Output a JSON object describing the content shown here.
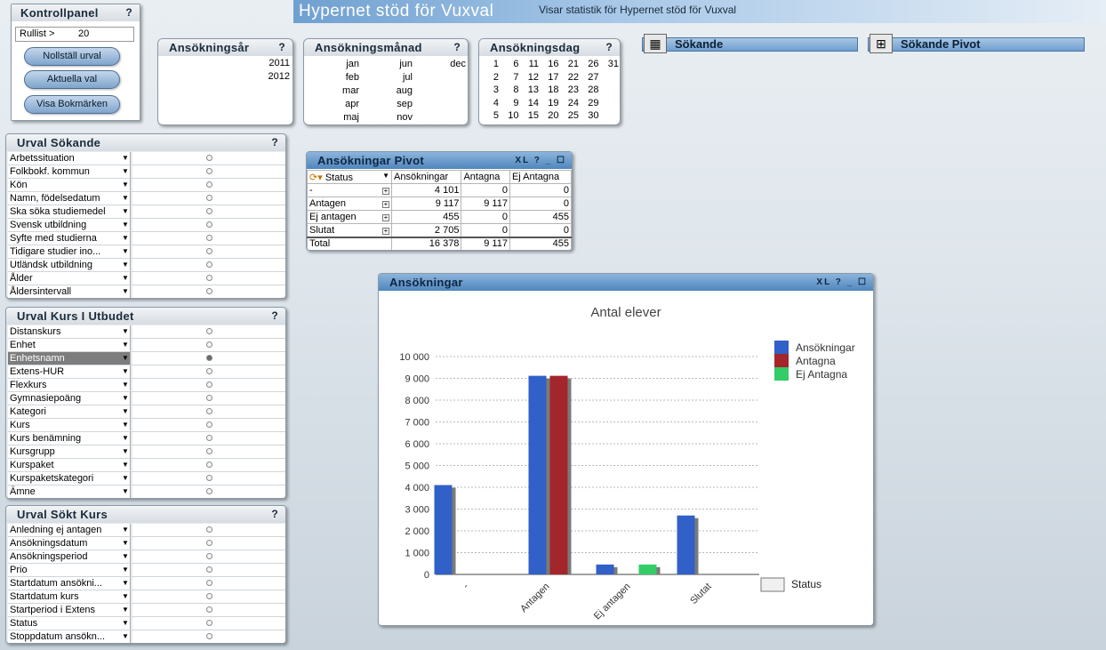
{
  "header": {
    "title": "Hypernet stöd för Vuxval",
    "subtitle": "Visar statistik för Hypernet stöd för Vuxval"
  },
  "kontrollpanel": {
    "title": "Kontrollpanel",
    "help": "?",
    "rullist_label": "Rullist >",
    "rullist_value": "20",
    "buttons": [
      "Nollställ urval",
      "Aktuella val",
      "Visa Bokmärken"
    ]
  },
  "ansokningsar": {
    "title": "Ansökningsår",
    "help": "?",
    "values": [
      "2011",
      "2012"
    ]
  },
  "ansokningsmanad": {
    "title": "Ansökningsmånad",
    "help": "?",
    "col1": [
      "jan",
      "feb",
      "mar",
      "apr",
      "maj"
    ],
    "col2": [
      "jun",
      "jul",
      "aug",
      "sep",
      "nov"
    ],
    "col3": [
      "dec"
    ]
  },
  "ansokningsdag": {
    "title": "Ansökningsdag",
    "help": "?",
    "cols": [
      [
        "1",
        "2",
        "3",
        "4",
        "5"
      ],
      [
        "6",
        "7",
        "8",
        "9",
        "10"
      ],
      [
        "11",
        "12",
        "13",
        "14",
        "15"
      ],
      [
        "16",
        "17",
        "18",
        "19",
        "20"
      ],
      [
        "21",
        "22",
        "23",
        "24",
        "25"
      ],
      [
        "26",
        "27",
        "28",
        "29",
        "30"
      ],
      [
        "31"
      ]
    ]
  },
  "bookmarks": {
    "sokande": "Sökande",
    "sokande_pivot": "Sökande Pivot"
  },
  "urval_sokande": {
    "title": "Urval Sökande",
    "help": "?",
    "fields": [
      "Arbetssituation",
      "Folkbokf. kommun",
      "Kön",
      "Namn, födelsedatum",
      "Ska söka studiemedel",
      "Svensk utbildning",
      "Syfte med studierna",
      "Tidigare studier ino...",
      "Utländsk utbildning",
      "Ålder",
      "Åldersintervall"
    ]
  },
  "urval_kurs": {
    "title": "Urval Kurs I Utbudet",
    "help": "?",
    "fields": [
      "Distanskurs",
      "Enhet",
      "Enhetsnamn",
      "Extens-HUR",
      "Flexkurs",
      "Gymnasiepoäng",
      "Kategori",
      "Kurs",
      "Kurs benämning",
      "Kursgrupp",
      "Kurspaket",
      "Kurspaketskategori",
      "Ämne"
    ],
    "selected_index": 2
  },
  "urval_sokt_kurs": {
    "title": "Urval Sökt Kurs",
    "help": "?",
    "fields": [
      "Anledning ej antagen",
      "Ansökningsdatum",
      "Ansökningsperiod",
      "Prio",
      "Startdatum ansökni...",
      "Startdatum kurs",
      "Startperiod i Extens",
      "Status",
      "Stoppdatum ansökn..."
    ]
  },
  "pivot": {
    "title": "Ansökningar Pivot",
    "toolbar": "XL ? _ ☐",
    "headers": [
      "Status",
      "Ansökningar",
      "Antagna",
      "Ej Antagna"
    ],
    "rows": [
      [
        "-",
        "4 101",
        "0",
        "0"
      ],
      [
        "Antagen",
        "9 117",
        "9 117",
        "0"
      ],
      [
        "Ej antagen",
        "455",
        "0",
        "455"
      ],
      [
        "Slutat",
        "2 705",
        "0",
        "0"
      ]
    ],
    "total": [
      "Total",
      "16 378",
      "9 117",
      "455"
    ]
  },
  "chart_box": {
    "title": "Ansökningar",
    "toolbar": "XL ? _ ☐",
    "dim_label": "Status"
  },
  "chart_data": {
    "type": "bar",
    "title": "Antal elever",
    "categories": [
      "-",
      "Antagen",
      "Ej antagen",
      "Slutat"
    ],
    "series": [
      {
        "name": "Ansökningar",
        "values": [
          4101,
          9117,
          455,
          2705
        ],
        "color": "#3060c8"
      },
      {
        "name": "Antagna",
        "values": [
          0,
          9117,
          0,
          0
        ],
        "color": "#a3262a"
      },
      {
        "name": "Ej Antagna",
        "values": [
          0,
          0,
          455,
          0
        ],
        "color": "#33cc66"
      }
    ],
    "ylim": [
      0,
      10000
    ],
    "yticks": [
      "0",
      "1 000",
      "2 000",
      "3 000",
      "4 000",
      "5 000",
      "6 000",
      "7 000",
      "8 000",
      "9 000",
      "10 000"
    ],
    "grid": true,
    "legend": "top-right"
  }
}
